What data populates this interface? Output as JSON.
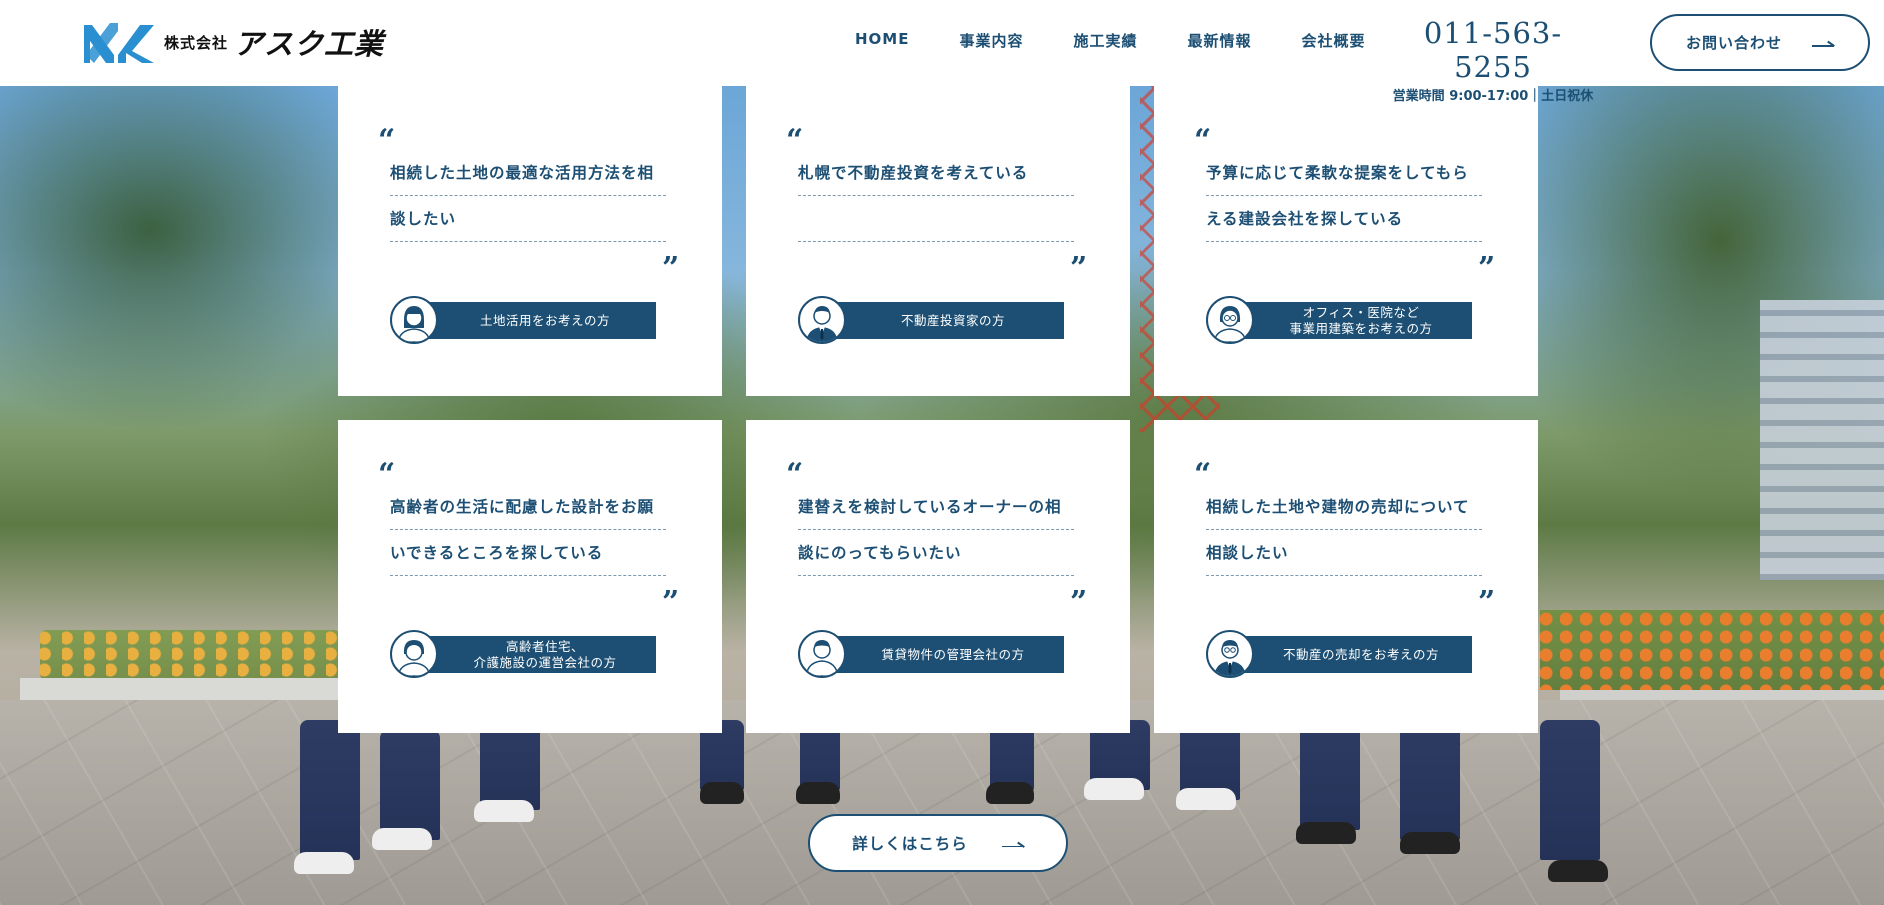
{
  "header": {
    "logo": {
      "prefix": "株式会社",
      "name": "アスク工業",
      "brand_color": "#2a8fd0",
      "icon": "ak-logo-icon"
    },
    "nav": [
      "HOME",
      "事業内容",
      "施工実績",
      "最新情報",
      "会社概要"
    ],
    "phone": "011-563-5255",
    "hours": "営業時間 9:00-17:00｜土日祝休",
    "contact_label": "お問い合わせ",
    "contact_icon": "arrow-right-icon"
  },
  "cards": [
    {
      "line1": "相続した土地の最適な活用方法を相",
      "line2": "談したい",
      "persona": "土地活用をお考えの方",
      "avatar": "woman-icon"
    },
    {
      "line1": "札幌で不動産投資を考えている",
      "line2": "",
      "persona": "不動産投資家の方",
      "avatar": "businessman-icon"
    },
    {
      "line1": "予算に応じて柔軟な提案をしてもら",
      "line2": "える建設会社を探している",
      "persona": "オフィス・医院など\n事業用建築をお考えの方",
      "avatar": "glasses-woman-icon"
    },
    {
      "line1": "高齢者の生活に配慮した設計をお願",
      "line2": "いできるところを探している",
      "persona": "高齢者住宅、\n介護施設の運営会社の方",
      "avatar": "woman-short-hair-icon"
    },
    {
      "line1": "建替えを検討しているオーナーの相",
      "line2": "談にのってもらいたい",
      "persona": "賃貸物件の管理会社の方",
      "avatar": "man-icon"
    },
    {
      "line1": "相続した土地や建物の売却について",
      "line2": "相談したい",
      "persona": "不動産の売却をお考えの方",
      "avatar": "man-glasses-tie-icon"
    }
  ],
  "quote_open": "“",
  "quote_close": "”",
  "more_button": {
    "label": "詳しくはこちら",
    "icon": "arrow-right-icon"
  },
  "colors": {
    "primary": "#1c4f73",
    "dash": "#7a9ab2",
    "card_bg": "#ffffff"
  }
}
